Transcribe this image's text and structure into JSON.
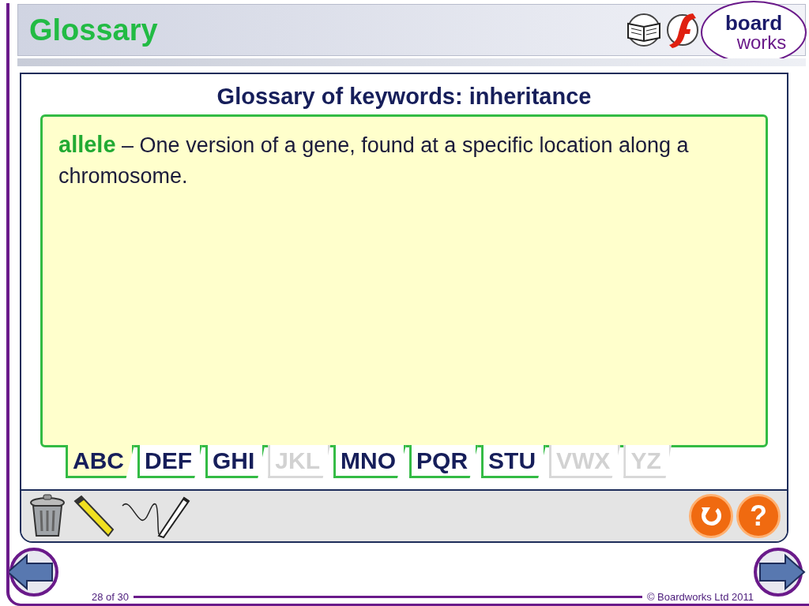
{
  "header": {
    "title": "Glossary",
    "logo": {
      "line_1": "board",
      "line_2": "works"
    }
  },
  "panel": {
    "title": "Glossary of keywords: inheritance",
    "entry": {
      "term": "allele",
      "definition": "– One version of a gene, found at a specific location along a chromosome."
    },
    "tabs": [
      {
        "label": "ABC",
        "selected": true,
        "disabled": false
      },
      {
        "label": "DEF",
        "selected": false,
        "disabled": false
      },
      {
        "label": "GHI",
        "selected": false,
        "disabled": false
      },
      {
        "label": "JKL",
        "selected": false,
        "disabled": true
      },
      {
        "label": "MNO",
        "selected": false,
        "disabled": false
      },
      {
        "label": "PQR",
        "selected": false,
        "disabled": false
      },
      {
        "label": "STU",
        "selected": false,
        "disabled": false
      },
      {
        "label": "VWX",
        "selected": false,
        "disabled": true
      },
      {
        "label": "YZ",
        "selected": false,
        "disabled": true
      }
    ],
    "help_button": "?"
  },
  "footer": {
    "page": "28 of 30",
    "copyright": "© Boardworks Ltd 2011"
  }
}
